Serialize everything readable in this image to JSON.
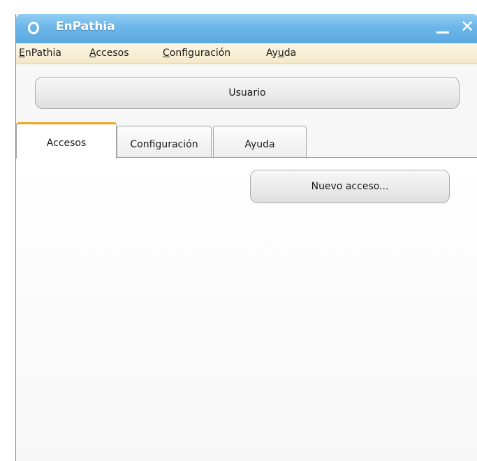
{
  "window": {
    "title": "EnPathia"
  },
  "menubar": {
    "items": [
      {
        "mnemonic": "E",
        "rest": "nPathia"
      },
      {
        "mnemonic": "A",
        "rest": "ccesos"
      },
      {
        "mnemonic": "C",
        "rest": "onfiguración"
      },
      {
        "before": "Ay",
        "mnemonic": "u",
        "rest": "da"
      }
    ]
  },
  "user_button": {
    "label": "Usuario"
  },
  "tabs": [
    {
      "label": "Accesos",
      "active": true
    },
    {
      "label": "Configuración",
      "active": false
    },
    {
      "label": "Ayuda",
      "active": false
    }
  ],
  "panel": {
    "new_access_label": "Nuevo acceso..."
  },
  "colors": {
    "titlebar": "#6cb6e9",
    "menubar": "#f3e8c8",
    "active_tab_accent": "#f3a21a"
  }
}
